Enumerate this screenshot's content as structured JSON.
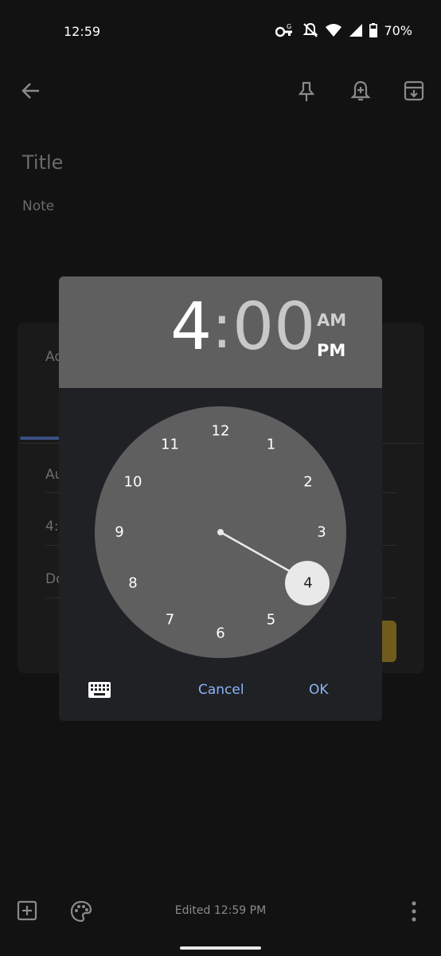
{
  "status_bar": {
    "time": "12:59",
    "battery": "70%"
  },
  "note": {
    "title_placeholder": "Title",
    "note_placeholder": "Note"
  },
  "background_sheet": {
    "header_fragment": "Ad",
    "rows": [
      "Au",
      "4:0",
      "Do"
    ]
  },
  "time_picker": {
    "hour": "4",
    "separator": ":",
    "minutes": "00",
    "am_label": "AM",
    "pm_label": "PM",
    "selected_period": "PM",
    "selected_hour": 4,
    "clock_numbers": [
      "12",
      "1",
      "2",
      "3",
      "4",
      "5",
      "6",
      "7",
      "8",
      "9",
      "10",
      "11"
    ],
    "cancel_label": "Cancel",
    "ok_label": "OK"
  },
  "footer": {
    "edited": "Edited 12:59 PM"
  },
  "colors": {
    "accent": "#8ab4f8",
    "dialog_bg": "#202124",
    "header_bg": "#5f5f5f",
    "selector": "#e9e9e9"
  }
}
